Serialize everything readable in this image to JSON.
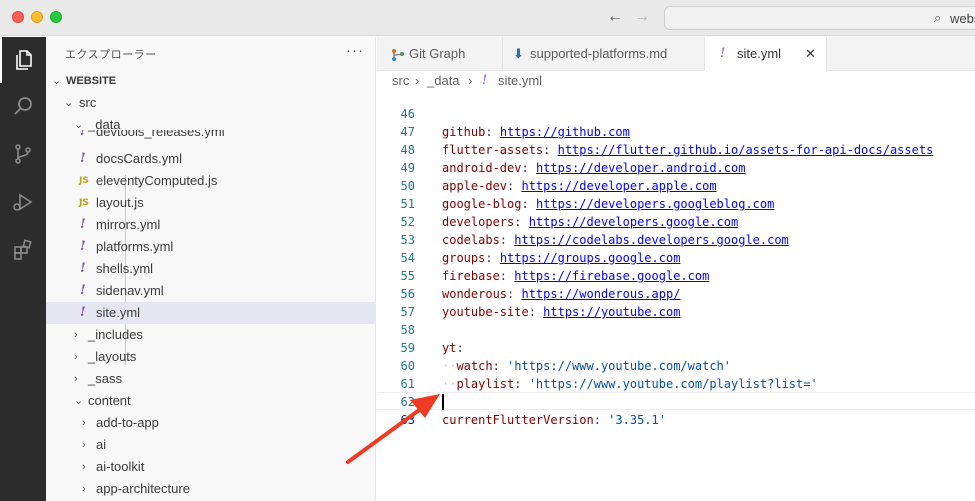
{
  "titlebar": {
    "search_text": "website"
  },
  "sidebar": {
    "title": "エクスプローラー",
    "more": "···",
    "tree": [
      {
        "label": "WEBSITE",
        "chevron": "⌄",
        "kind": "root"
      },
      {
        "label": "src",
        "chevron": "⌄",
        "kind": "folder"
      },
      {
        "label": "_data",
        "chevron": "⌄",
        "kind": "folder"
      },
      {
        "label": "devtools_releases.yml",
        "kind": "yml"
      },
      {
        "label": "docsCards.yml",
        "kind": "yml"
      },
      {
        "label": "eleventyComputed.js",
        "kind": "js"
      },
      {
        "label": "layout.js",
        "kind": "js"
      },
      {
        "label": "mirrors.yml",
        "kind": "yml"
      },
      {
        "label": "platforms.yml",
        "kind": "yml"
      },
      {
        "label": "shells.yml",
        "kind": "yml"
      },
      {
        "label": "sidenav.yml",
        "kind": "yml"
      },
      {
        "label": "site.yml",
        "kind": "yml"
      },
      {
        "label": "_includes",
        "chevron": "›",
        "kind": "folder"
      },
      {
        "label": "_layouts",
        "chevron": "›",
        "kind": "folder"
      },
      {
        "label": "_sass",
        "chevron": "›",
        "kind": "folder"
      },
      {
        "label": "content",
        "chevron": "⌄",
        "kind": "folder"
      },
      {
        "label": "add-to-app",
        "chevron": "›",
        "kind": "folder"
      },
      {
        "label": "ai",
        "chevron": "›",
        "kind": "folder"
      },
      {
        "label": "ai-toolkit",
        "chevron": "›",
        "kind": "folder"
      },
      {
        "label": "app-architecture",
        "chevron": "›",
        "kind": "folder"
      }
    ]
  },
  "tabs": [
    {
      "label": "Git Graph",
      "icon": "git-graph-icon"
    },
    {
      "label": "supported-platforms.md",
      "icon": "markdown-icon"
    },
    {
      "label": "site.yml",
      "icon": "yaml-icon",
      "close": "✕"
    }
  ],
  "breadcrumb": {
    "parts": [
      "src",
      "›",
      "_data",
      "›",
      "!",
      "site.yml"
    ]
  },
  "icons": {
    "yml": "!",
    "js": "JS"
  },
  "editor": {
    "lines": [
      {
        "n": "46",
        "key": "github",
        "colon": ": ",
        "url": "https://github.com"
      },
      {
        "n": "47",
        "key": "flutter-assets",
        "colon": ": ",
        "url": "https://flutter.github.io/assets-for-api-docs/assets"
      },
      {
        "n": "48",
        "key": "android-dev",
        "colon": ": ",
        "url": "https://developer.android.com"
      },
      {
        "n": "49",
        "key": "apple-dev",
        "colon": ": ",
        "url": "https://developer.apple.com"
      },
      {
        "n": "50",
        "key": "google-blog",
        "colon": ": ",
        "url": "https://developers.googleblog.com"
      },
      {
        "n": "51",
        "key": "developers",
        "colon": ": ",
        "url": "https://developers.google.com"
      },
      {
        "n": "52",
        "key": "codelabs",
        "colon": ": ",
        "url": "https://codelabs.developers.google.com"
      },
      {
        "n": "53",
        "key": "groups",
        "colon": ": ",
        "url": "https://groups.google.com"
      },
      {
        "n": "54",
        "key": "firebase",
        "colon": ": ",
        "url": "https://firebase.google.com"
      },
      {
        "n": "55",
        "key": "wonderous",
        "colon": ": ",
        "url": "https://wonderous.app/"
      },
      {
        "n": "56",
        "key": "youtube-site",
        "colon": ": ",
        "url": "https://youtube.com"
      },
      {
        "n": "57"
      },
      {
        "n": "58",
        "key": "yt",
        "colon": ":"
      },
      {
        "n": "59",
        "indent": "··",
        "key": "watch",
        "colon": ": ",
        "str": "'https://www.youtube.com/watch'"
      },
      {
        "n": "60",
        "indent": "··",
        "key": "playlist",
        "colon": ": ",
        "str": "'https://www.youtube.com/playlist?list='"
      },
      {
        "n": "61"
      },
      {
        "n": "62",
        "key": "currentFlutterVersion",
        "colon": ": ",
        "str": "'3.35.1'"
      },
      {
        "n": "63"
      }
    ]
  },
  "colors": {
    "annotation_arrow": "#ee3b24",
    "yaml_key": "#800000",
    "link": "#0000ff",
    "string": "#0451a5"
  }
}
